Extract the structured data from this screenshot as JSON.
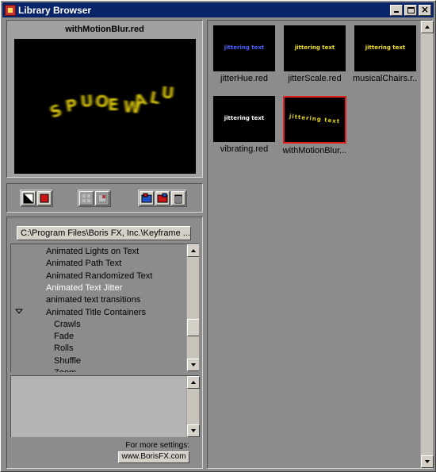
{
  "window": {
    "title": "Library Browser"
  },
  "preview": {
    "title": "withMotionBlur.red",
    "screen_text": "SPUOEWALU"
  },
  "browser": {
    "path": "C:\\Program Files\\Boris FX, Inc.\\Keyframe ...",
    "tree": [
      {
        "label": "Animated Lights on Text",
        "level": 0,
        "selected": false
      },
      {
        "label": "Animated Path Text",
        "level": 0,
        "selected": false
      },
      {
        "label": "Animated Randomized Text",
        "level": 0,
        "selected": false
      },
      {
        "label": "Animated Text Jitter",
        "level": 0,
        "selected": true
      },
      {
        "label": "animated text transitions",
        "level": 0,
        "selected": false
      },
      {
        "label": "Animated Title Containers",
        "level": 0,
        "selected": false,
        "expanded": true
      },
      {
        "label": "Crawls",
        "level": 1,
        "selected": false
      },
      {
        "label": "Fade",
        "level": 1,
        "selected": false
      },
      {
        "label": "Rolls",
        "level": 1,
        "selected": false
      },
      {
        "label": "Shuffle",
        "level": 1,
        "selected": false
      },
      {
        "label": "Zoom",
        "level": 1,
        "selected": false
      }
    ],
    "more_settings_label": "For more settings:",
    "website_label": "www.BorisFX.com"
  },
  "thumbnails": [
    {
      "label": "jitterHue.red",
      "preview_text": "jittering text",
      "color": "#4a60ff",
      "selected": false
    },
    {
      "label": "jitterScale.red",
      "preview_text": "jittering text",
      "color": "#f0e020",
      "selected": false
    },
    {
      "label": "musicalChairs.r...",
      "preview_text": "jittering text",
      "color": "#f0e020",
      "selected": false
    },
    {
      "label": "vibrating.red",
      "preview_text": "jittering text",
      "color": "#ffffff",
      "selected": false
    },
    {
      "label": "withMotionBlur...",
      "preview_text": "jittering text",
      "color": "#e8d818",
      "selected": true
    }
  ],
  "colors": {
    "title_bar": "#0a246a",
    "panel_bg": "#8c8c8c",
    "selection_border": "#e02020",
    "preview_text": "#d8c410"
  }
}
